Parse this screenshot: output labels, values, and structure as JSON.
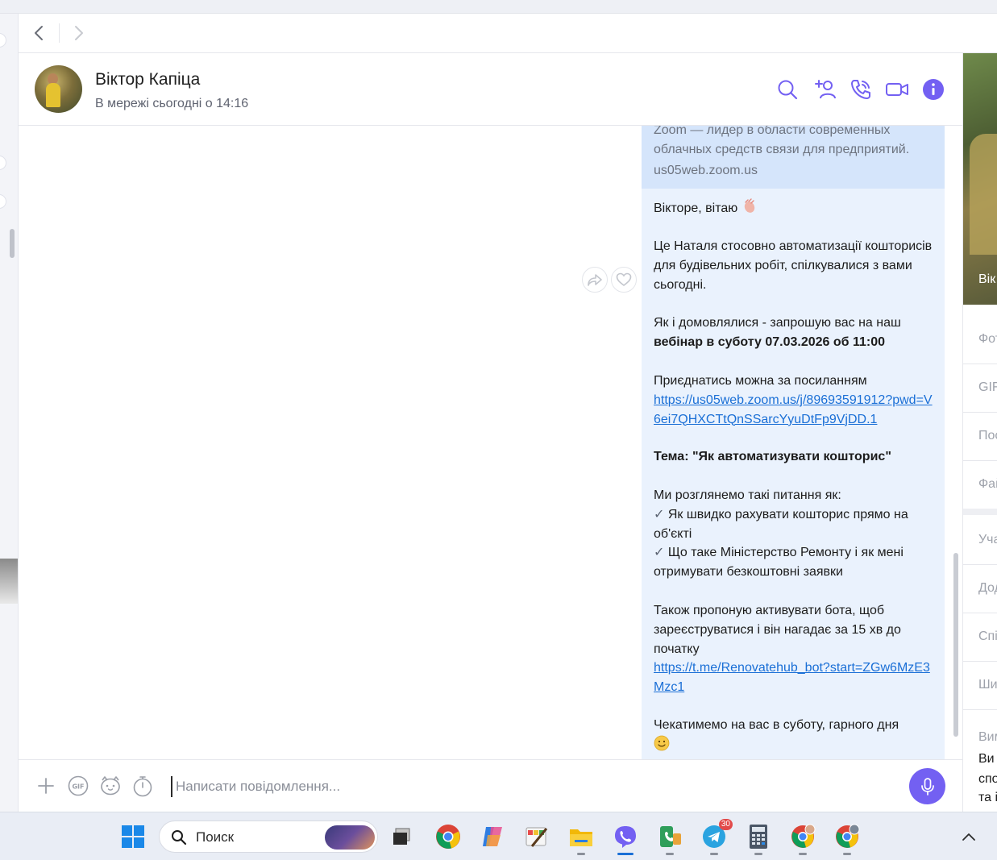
{
  "window": {
    "nav": {
      "back_icon": "chevron-left-icon",
      "forward_icon": "chevron-right-icon"
    }
  },
  "contact": {
    "name": "Віктор Капіца",
    "status": "В мережі сьогодні о 14:16"
  },
  "header_actions": [
    "search-icon",
    "add-participant-icon",
    "phone-icon",
    "video-icon",
    "info-icon"
  ],
  "chat": {
    "link_preview": {
      "description": "Zoom — лидер в области современных облачных средств связи для предприятий.",
      "domain": "us05web.zoom.us"
    },
    "message": {
      "greeting": "Вікторе, вітаю",
      "intro": "Це Наталя стосовно автоматизації кошторисів для будівельних робіт, спілкувалися з вами сьогодні.",
      "invite_line1": "Як і домовлялися - запрошую вас на наш",
      "invite_bold": "вебінар в суботу  07.03.2026 об 11:00",
      "join_text": "Приєднатись можна за посиланням",
      "zoom_link": "https://us05web.zoom.us/j/89693591912?pwd=V6ei7QHXCTtQnSSarcYyuDtFp9VjDD.1",
      "topic": "Тема: \"Як автоматизувати кошторис\"",
      "points_intro": "Ми розглянемо такі питання як:",
      "point1": "Як швидко рахувати кошторис прямо на об'єкті",
      "point2": "Що таке Міністерство Ремонту і як мені отримувати безкоштовні заявки",
      "bot_text": "Також пропоную активувати бота, щоб зареєструватися і він нагадає за 15 хв до початку",
      "bot_link": "https://t.me/Renovatehub_bot?start=ZGw6MzE3Mzc1",
      "closing": "Чекатимемо на вас в суботу, гарного дня",
      "check_glyph": "✓",
      "emoji_wave": "wave-emoji",
      "emoji_smile": "smile-emoji"
    },
    "reactions": [
      "share-icon",
      "heart-icon"
    ]
  },
  "composer": {
    "placeholder": "Написати повідомлення...",
    "gif_label": "GIF",
    "icons": [
      "plus-icon",
      "gif-icon",
      "sticker-icon",
      "timer-icon",
      "microphone-icon"
    ]
  },
  "right_panel": {
    "photo_name": "Вік",
    "rows": [
      "Фот",
      "GIF",
      "Пос",
      "Фай",
      "Уча",
      "Дод",
      "Спі",
      "Ши"
    ],
    "section_title": "Вим",
    "section_lines": [
      "Ви",
      "спо",
      "та і"
    ]
  },
  "taskbar": {
    "search_label": "Поиск",
    "telegram_badge": "30",
    "apps": [
      "windows-start-icon",
      "search-icon",
      "task-view-icon",
      "chrome-icon",
      "copilot-icon",
      "paint-icon",
      "file-explorer-icon",
      "viber-icon",
      "phone-link-icon",
      "telegram-icon",
      "calculator-icon",
      "chrome-profile-1-icon",
      "chrome-profile-2-icon",
      "chevron-up-icon"
    ]
  },
  "colors": {
    "accent": "#7360f2",
    "bubble": "#eaf2fd",
    "preview": "#d5e5fb",
    "link": "#1a6fd6"
  }
}
